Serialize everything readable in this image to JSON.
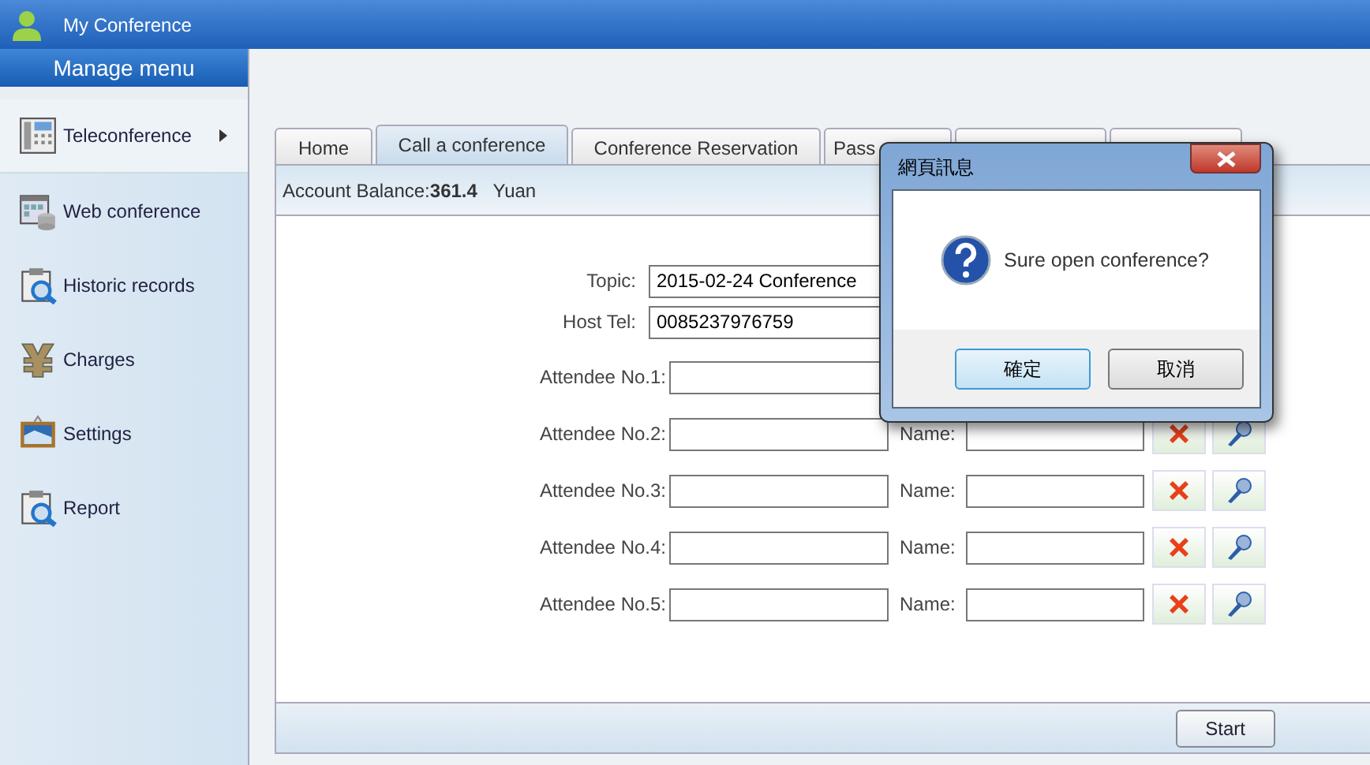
{
  "window": {
    "title": "My Conference"
  },
  "sidebar": {
    "header": "Manage menu",
    "items": [
      {
        "label": "Teleconference",
        "selected": true
      },
      {
        "label": "Web conference",
        "selected": false
      },
      {
        "label": "Historic records",
        "selected": false
      },
      {
        "label": "Charges",
        "selected": false
      },
      {
        "label": "Settings",
        "selected": false
      },
      {
        "label": "Report",
        "selected": false
      }
    ]
  },
  "tabs": [
    {
      "label": "Home",
      "selected": false
    },
    {
      "label": "Call a conference",
      "selected": true
    },
    {
      "label": "Conference Reservation",
      "selected": false
    },
    {
      "label": "Pass",
      "selected": false
    },
    {
      "selected": false
    },
    {
      "selected": false
    }
  ],
  "balance": {
    "label": "Account Balance:",
    "amount": "361.4",
    "unit": "Yuan"
  },
  "form": {
    "topic": {
      "label": "Topic:",
      "value": "2015-02-24 Conference"
    },
    "host_tel": {
      "label": "Host Tel:",
      "value": "0085237976759"
    },
    "attendees": [
      {
        "label": "Attendee No.1:"
      },
      {
        "label": "Attendee No.2:",
        "name_label": "Name:"
      },
      {
        "label": "Attendee No.3:",
        "name_label": "Name:"
      },
      {
        "label": "Attendee No.4:",
        "name_label": "Name:"
      },
      {
        "label": "Attendee No.5:",
        "name_label": "Name:"
      }
    ]
  },
  "footer": {
    "button": "Start"
  },
  "dialog": {
    "title": "網頁訊息",
    "message": "Sure open conference?",
    "buttons": [
      {
        "label": "確定",
        "selected": true
      },
      {
        "label": "取消",
        "selected": false
      }
    ]
  }
}
